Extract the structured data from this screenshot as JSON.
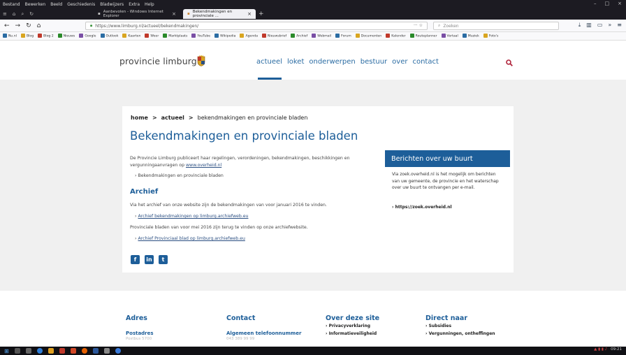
{
  "browser": {
    "menu": [
      "Bestand",
      "Bewerken",
      "Beeld",
      "Geschiedenis",
      "Bladwijzers",
      "Extra",
      "Help"
    ],
    "window_controls": [
      "–",
      "□",
      "×"
    ],
    "tabs": [
      {
        "title": "Aanbevolen - Windows Internet Explorer"
      },
      {
        "title": "Bekendmakingen en provinciale ..."
      }
    ],
    "url": "https://www.limburg.nl/actueel/bekendmakingen/",
    "url_menu": "···",
    "search_placeholder": "Zoeken",
    "bookmarks": [
      "Nu.nl",
      "Blog",
      "Blog 2",
      "Nieuws",
      "Google",
      "Outlook",
      "Kaarten",
      "Weer",
      "Marktplaats",
      "YouTube",
      "Wikipedia",
      "Agenda",
      "Nieuwsbrief",
      "Archief",
      "Webmail",
      "Forum",
      "Documenten",
      "Kalender",
      "Routeplanner",
      "Vertaal",
      "Muziek",
      "Foto's"
    ]
  },
  "site": {
    "logo_text": "provincie limburg",
    "nav": [
      "actueel",
      "loket",
      "onderwerpen",
      "bestuur",
      "over",
      "contact"
    ],
    "breadcrumb": {
      "home": "home",
      "sep": ">",
      "section": "actueel",
      "current": "bekendmakingen en provinciale bladen"
    },
    "title": "Bekendmakingen en provinciale bladen",
    "intro_text": "De Provincie Limburg publiceert haar regelingen, verordeningen, bekendmakingen, beschikkingen en vergunningaanvragen op ",
    "intro_link": "www.overheid.nl",
    "bullet1": "Bekendmakingen en provinciale bladen",
    "archive_heading": "Archief",
    "archive_para1": "Via het archief van onze website zijn de bekendmakingen van voor januari 2016 te vinden.",
    "archive_link1": "Archief bekendmakingen op limburg.archiefweb.eu",
    "archive_para2": "Provinciale bladen van voor mei 2016 zijn terug te vinden op onze archiefwebsite.",
    "archive_link2": "Archief Provinciaal blad op limburg.archiefweb.eu",
    "social": {
      "facebook": "f",
      "linkedin": "in",
      "twitter": "t"
    },
    "sidebox": {
      "heading": "Berichten over uw buurt",
      "text": "Via zoek.overheid.nl is het mogelijk om berichten van uw gemeente, de provincie en het waterschap over uw buurt te ontvangen per e-mail.",
      "link": "https://zoek.overheid.nl"
    }
  },
  "footer": {
    "adres": {
      "heading": "Adres",
      "sub": "Postadres",
      "faint": "Postbus 5700"
    },
    "contact": {
      "heading": "Contact",
      "sub": "Algemeen telefoonnummer",
      "faint": "043 389 99 99"
    },
    "over": {
      "heading": "Over deze site",
      "links": [
        "Privacyverklaring",
        "Informatieveiligheid"
      ]
    },
    "direct": {
      "heading": "Direct naar",
      "links": [
        "Subsidies",
        "Vergunningen, ontheffingen"
      ]
    }
  },
  "taskbar": {
    "clock": "09:21"
  },
  "colors": {
    "brand_blue": "#1d5e99",
    "link_blue": "#2b6ca3",
    "gray_bg": "#f0f0f0"
  }
}
